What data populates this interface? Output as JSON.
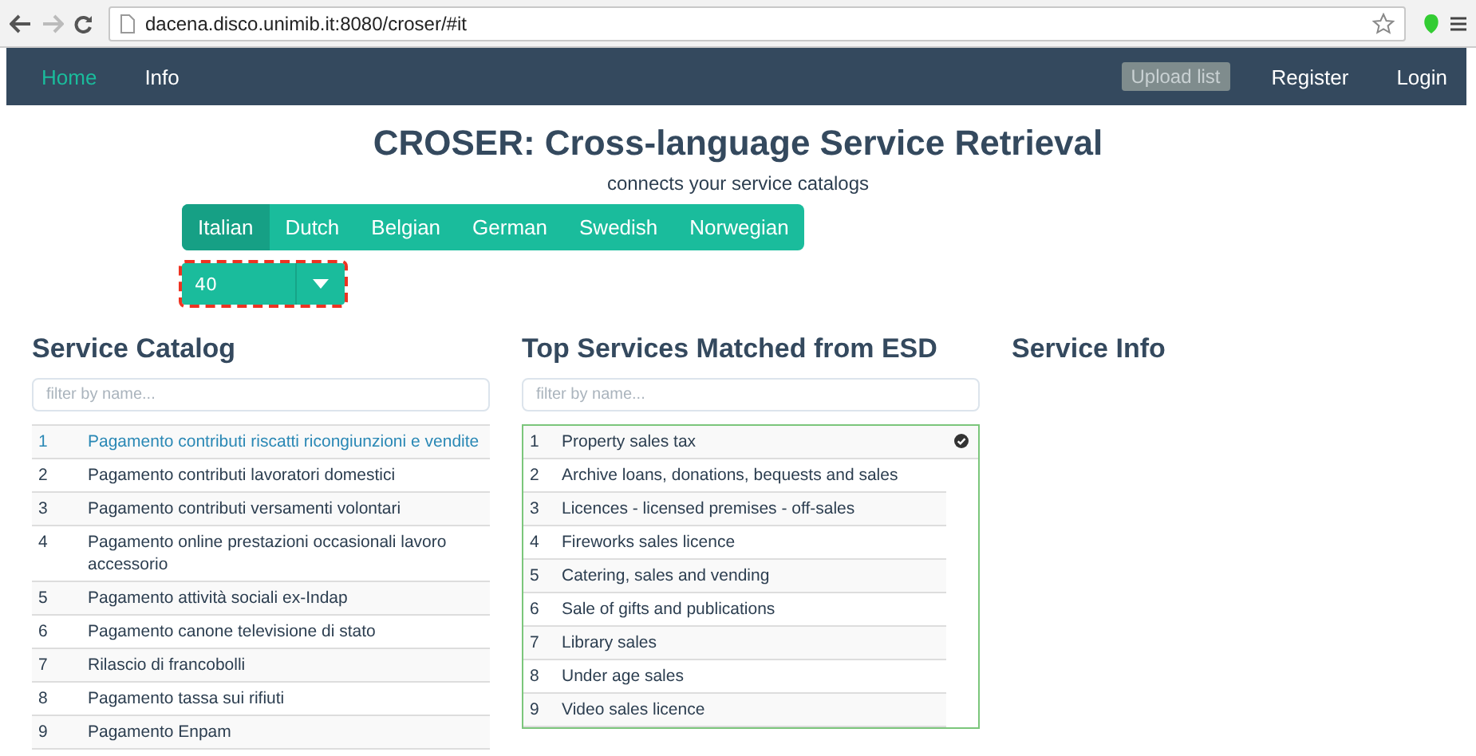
{
  "browser": {
    "url": "dacena.disco.unimib.it:8080/croser/#it"
  },
  "navbar": {
    "left": [
      {
        "label": "Home",
        "selected": true
      },
      {
        "label": "Info",
        "selected": false
      }
    ],
    "upload_button": "Upload list",
    "right": [
      {
        "label": "Register"
      },
      {
        "label": "Login"
      }
    ]
  },
  "title": "CROSER: Cross-language Service Retrieval",
  "subtitle": "connects your service catalogs",
  "language_tabs": [
    {
      "label": "Italian",
      "selected": true
    },
    {
      "label": "Dutch",
      "selected": false
    },
    {
      "label": "Belgian",
      "selected": false
    },
    {
      "label": "German",
      "selected": false
    },
    {
      "label": "Swedish",
      "selected": false
    },
    {
      "label": "Norwegian",
      "selected": false
    }
  ],
  "count_dropdown": {
    "value": "40"
  },
  "catalog": {
    "heading": "Service Catalog",
    "filter": {
      "placeholder": "filter by name..."
    },
    "rows": [
      {
        "number": "1",
        "name": "Pagamento contributi riscatti ricongiunzioni e vendite",
        "selected": true
      },
      {
        "number": "2",
        "name": "Pagamento contributi lavoratori domestici",
        "selected": false
      },
      {
        "number": "3",
        "name": "Pagamento contributi versamenti volontari",
        "selected": false
      },
      {
        "number": "4",
        "name": "Pagamento online prestazioni occasionali lavoro accessorio",
        "selected": false
      },
      {
        "number": "5",
        "name": "Pagamento attività sociali ex-Indap",
        "selected": false
      },
      {
        "number": "6",
        "name": "Pagamento canone televisione di stato",
        "selected": false
      },
      {
        "number": "7",
        "name": "Rilascio di francobolli",
        "selected": false
      },
      {
        "number": "8",
        "name": "Pagamento tassa sui rifiuti",
        "selected": false
      },
      {
        "number": "9",
        "name": "Pagamento Enpam",
        "selected": false
      }
    ]
  },
  "matches": {
    "heading": "Top Services Matched from ESD",
    "filter": {
      "placeholder": "filter by name..."
    },
    "rows": [
      {
        "number": "1",
        "name": "Property sales tax",
        "checked": true
      },
      {
        "number": "2",
        "name": "Archive loans, donations, bequests and sales",
        "checked": false
      },
      {
        "number": "3",
        "name": "Licences - licensed premises - off-sales",
        "checked": false
      },
      {
        "number": "4",
        "name": "Fireworks sales licence",
        "checked": false
      },
      {
        "number": "5",
        "name": "Catering, sales and vending",
        "checked": false
      },
      {
        "number": "6",
        "name": "Sale of gifts and publications",
        "checked": false
      },
      {
        "number": "7",
        "name": "Library sales",
        "checked": false
      },
      {
        "number": "8",
        "name": "Under age sales",
        "checked": false
      },
      {
        "number": "9",
        "name": "Video sales licence",
        "checked": false
      }
    ]
  },
  "info": {
    "heading": "Service Info"
  }
}
